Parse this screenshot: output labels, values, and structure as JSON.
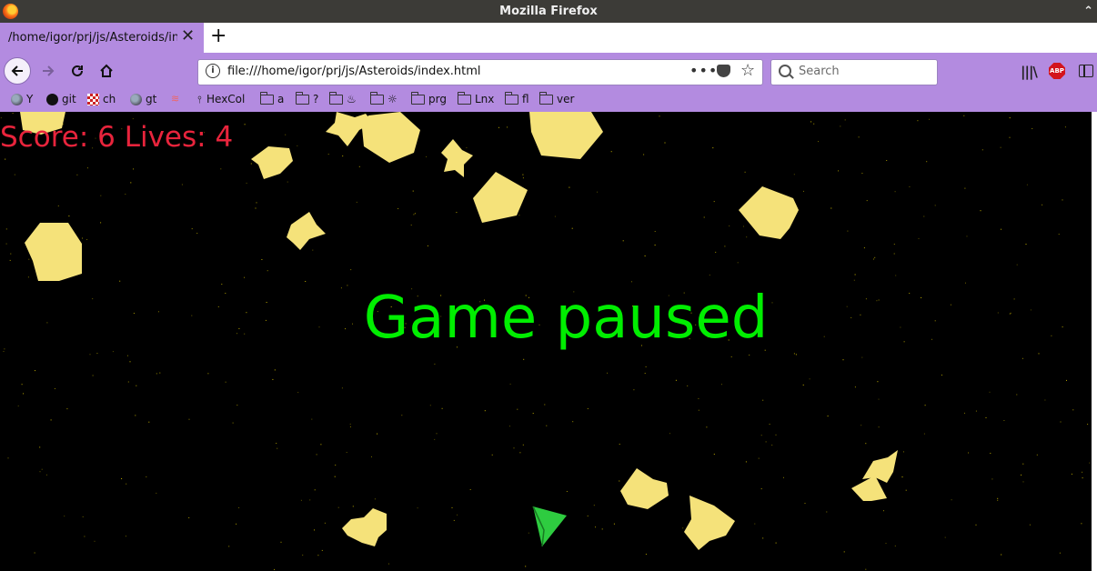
{
  "window": {
    "title": "Mozilla Firefox"
  },
  "tab": {
    "title": "/home/igor/prj/js/Asteroids/index.html"
  },
  "nav": {
    "url": "file:///home/igor/prj/js/Asteroids/index.html",
    "url_menu": "•••",
    "search_placeholder": "Search",
    "abp_label": "ABP"
  },
  "bookmarks": [
    {
      "label": "Y",
      "icon": "globe-icon"
    },
    {
      "label": "git",
      "icon": "github-icon"
    },
    {
      "label": "ch",
      "icon": "checker-icon"
    },
    {
      "label": "gt",
      "icon": "globe-icon"
    },
    {
      "label": "",
      "icon": "stackoverflow-icon"
    },
    {
      "label": "HexCol",
      "icon": "pin-icon"
    },
    {
      "label": "a",
      "icon": "folder-icon"
    },
    {
      "label": "?",
      "icon": "folder-icon"
    },
    {
      "label": "♨",
      "icon": "folder-icon"
    },
    {
      "label": "☼",
      "icon": "folder-icon"
    },
    {
      "label": "prg",
      "icon": "folder-icon"
    },
    {
      "label": "Lnx",
      "icon": "folder-icon"
    },
    {
      "label": "fl",
      "icon": "folder-icon"
    },
    {
      "label": "ver",
      "icon": "folder-icon"
    }
  ],
  "game": {
    "score_text": "Score: 6 Lives: 4",
    "paused_text": "Game paused",
    "score": 6,
    "lives": 4,
    "colors": {
      "asteroid": "#f5e27a",
      "ship": "#2ecc40",
      "score": "#e8243c",
      "paused": "#00ee00",
      "stars": "#c8b400"
    }
  }
}
